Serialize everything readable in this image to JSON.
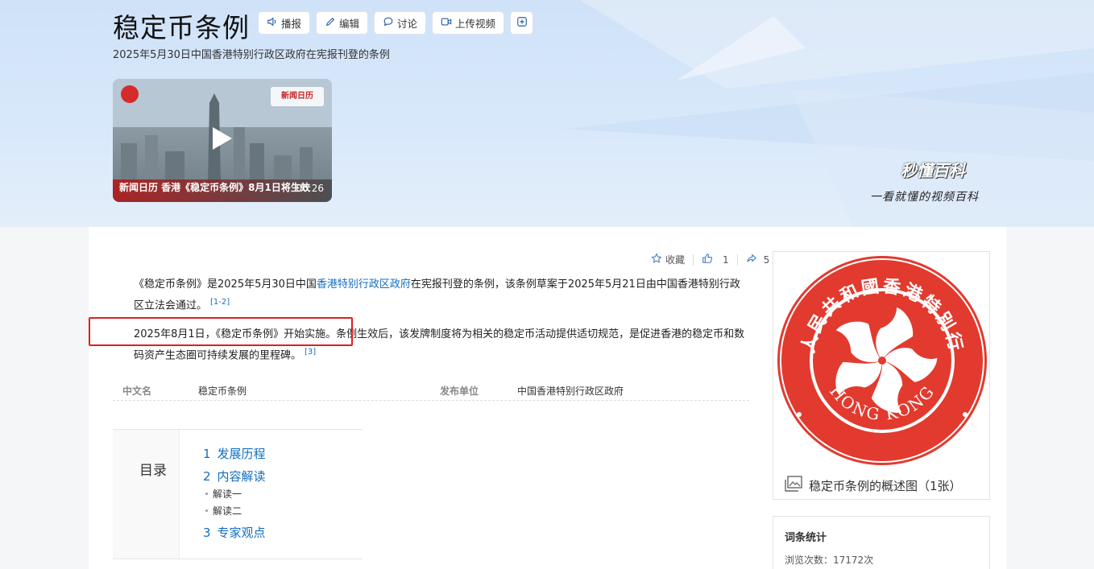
{
  "header": {
    "title": "稳定币条例",
    "subtitle": "2025年5月30日中国香港特别行政区政府在宪报刊登的条例",
    "actions": [
      {
        "label": "播报",
        "icon": "speaker-icon"
      },
      {
        "label": "编辑",
        "icon": "pencil-icon"
      },
      {
        "label": "讨论",
        "icon": "chat-icon"
      },
      {
        "label": "上传视频",
        "icon": "video-upload-icon"
      }
    ]
  },
  "video": {
    "brand_tag": "新闻日历",
    "caption": "新闻日历 香港《稳定币条例》8月1日将生效",
    "duration": "00:26"
  },
  "brand": {
    "name": "秒懂百科",
    "slogan": "一看就懂的视频百科"
  },
  "toolbar": {
    "collect_label": "收藏",
    "like_count": "1",
    "share_count": "5"
  },
  "content": {
    "p1_pre": "《稳定币条例》是2025年5月30日中国",
    "p1_link": "香港特别行政区政府",
    "p1_post": "在宪报刊登的条例，该条例草案于2025年5月21日由中国香港特别行政区立法会通过。",
    "p1_ref": "[1-2]",
    "p2_text": "2025年8月1日，《稳定币条例》开始实施。条例生效后，该发牌制度将为相关的稳定币活动提供适切规范，是促进香港的稳定币和数码资产生态圈可持续发展的里程碑。",
    "p2_ref": "[3]"
  },
  "basic_info": {
    "label1": "中文名",
    "value1": "稳定币条例",
    "label2": "发布单位",
    "value2": "中国香港特别行政区政府"
  },
  "toc": {
    "title": "目录",
    "items": [
      {
        "num": "1",
        "label": "发展历程"
      },
      {
        "num": "2",
        "label": "内容解读"
      },
      {
        "num": "3",
        "label": "专家观点"
      }
    ],
    "subitems": [
      "解读一",
      "解读二"
    ]
  },
  "sidebar": {
    "emblem_top_text": "中華人民共和國香港特別行政區",
    "emblem_bottom_text": "HONG KONG",
    "emblem_caption": "稳定币条例的概述图（1张）",
    "stats_title": "词条统计",
    "views_label": "浏览次数：",
    "views_value": "17172次"
  },
  "colors": {
    "link": "#136ec2",
    "emblem_red": "#e23a2e",
    "highlight_red": "#e01e1e"
  }
}
